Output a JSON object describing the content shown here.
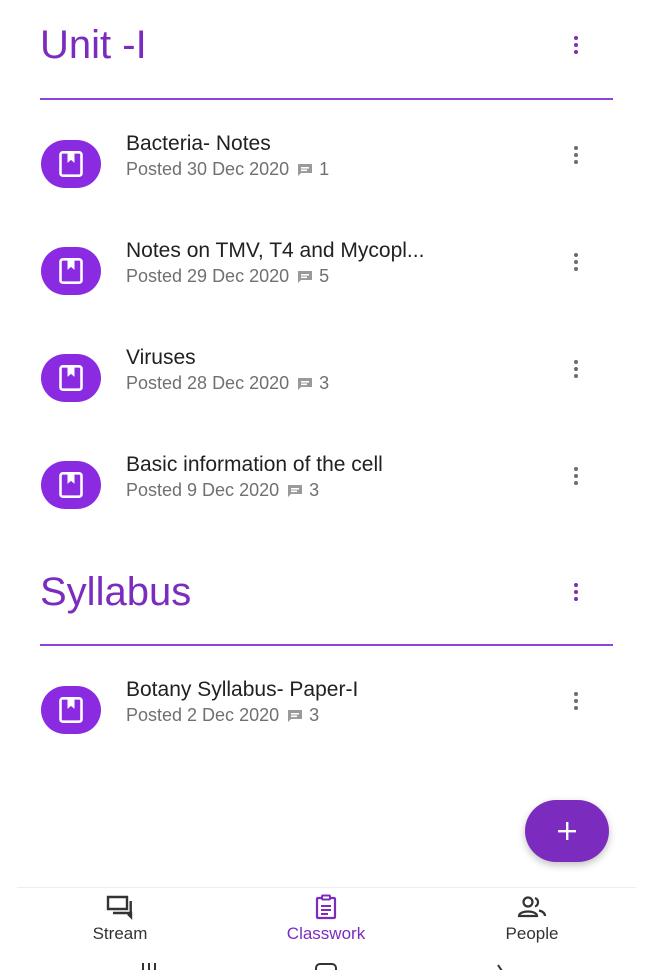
{
  "colors": {
    "accent": "#7b2cbf",
    "icon_bg": "#8a2be2",
    "divider": "#8e44d6",
    "meta_text": "#707070"
  },
  "sections": [
    {
      "title": "Unit -I",
      "items": [
        {
          "title": "Bacteria- Notes",
          "posted": "Posted 30 Dec 2020",
          "comments": "1"
        },
        {
          "title": "Notes on TMV, T4 and Mycopl...",
          "posted": "Posted 29 Dec 2020",
          "comments": "5"
        },
        {
          "title": "Viruses",
          "posted": "Posted 28 Dec 2020",
          "comments": "3"
        },
        {
          "title": "Basic information of the cell",
          "posted": "Posted 9 Dec 2020",
          "comments": "3"
        }
      ]
    },
    {
      "title": "Syllabus",
      "items": [
        {
          "title": "Botany Syllabus- Paper-I",
          "posted": "Posted 2 Dec 2020",
          "comments": "3"
        }
      ]
    }
  ],
  "fab": {
    "icon": "plus-icon"
  },
  "bottom_nav": {
    "stream": {
      "label": "Stream",
      "icon": "stream-icon"
    },
    "classwork": {
      "label": "Classwork",
      "icon": "classwork-icon",
      "active": true
    },
    "people": {
      "label": "People",
      "icon": "people-icon"
    }
  }
}
